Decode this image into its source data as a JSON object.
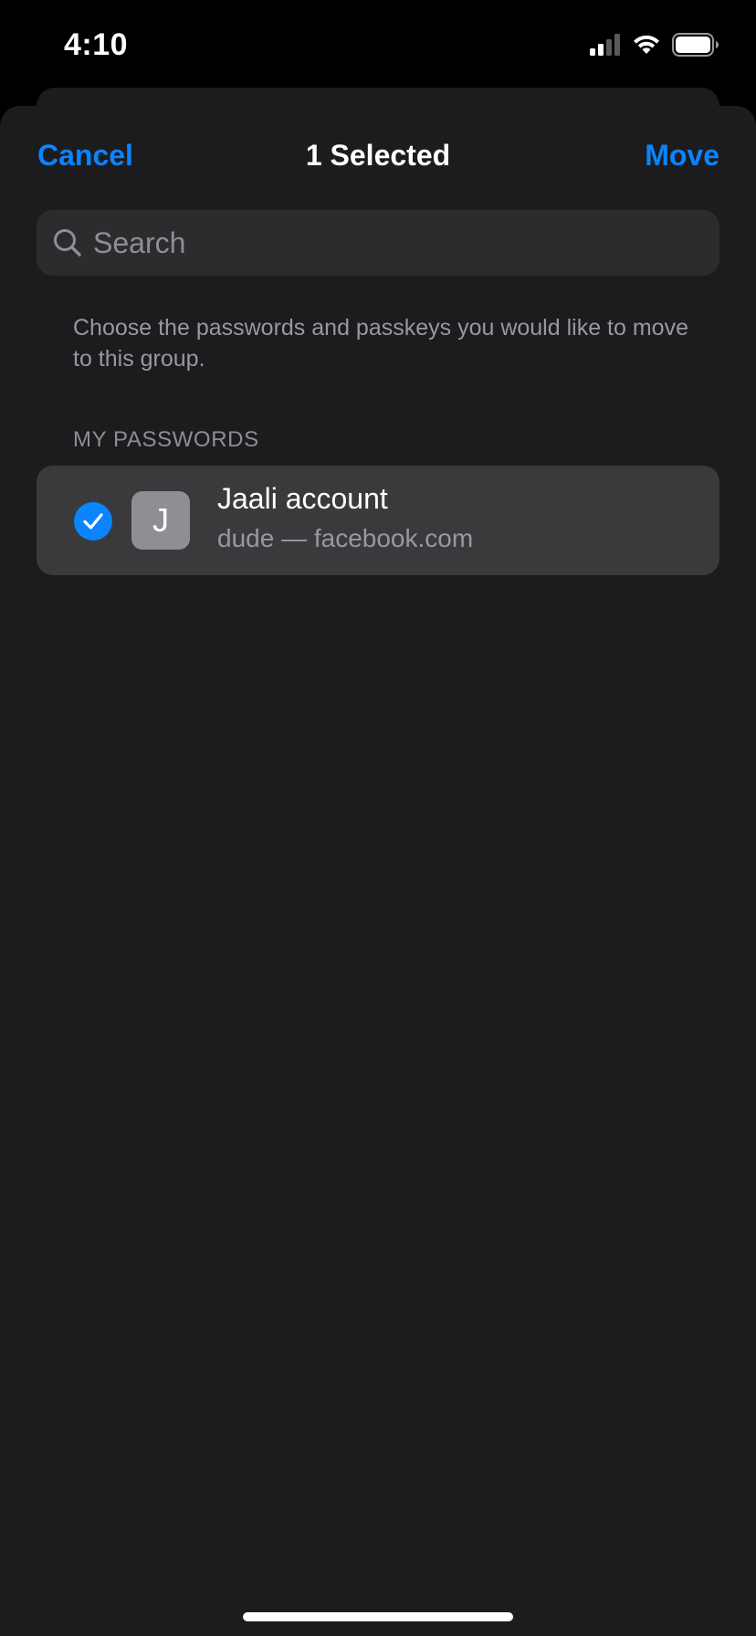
{
  "status_bar": {
    "time": "4:10",
    "icons": [
      "cellular-signal-icon",
      "wifi-icon",
      "battery-icon"
    ]
  },
  "nav": {
    "cancel_label": "Cancel",
    "title": "1 Selected",
    "move_label": "Move"
  },
  "search": {
    "placeholder": "Search",
    "value": ""
  },
  "description": "Choose the passwords and passkeys you would like to move to this group.",
  "section": {
    "header": "MY PASSWORDS",
    "items": [
      {
        "selected": true,
        "avatar_letter": "J",
        "title": "Jaali account",
        "subtitle": "dude — facebook.com"
      }
    ]
  },
  "colors": {
    "accent": "#0a84ff",
    "sheet_background": "#1c1c1e",
    "row_background": "#3a3a3c",
    "search_background": "#2c2c2e",
    "secondary_text": "#98989f"
  }
}
